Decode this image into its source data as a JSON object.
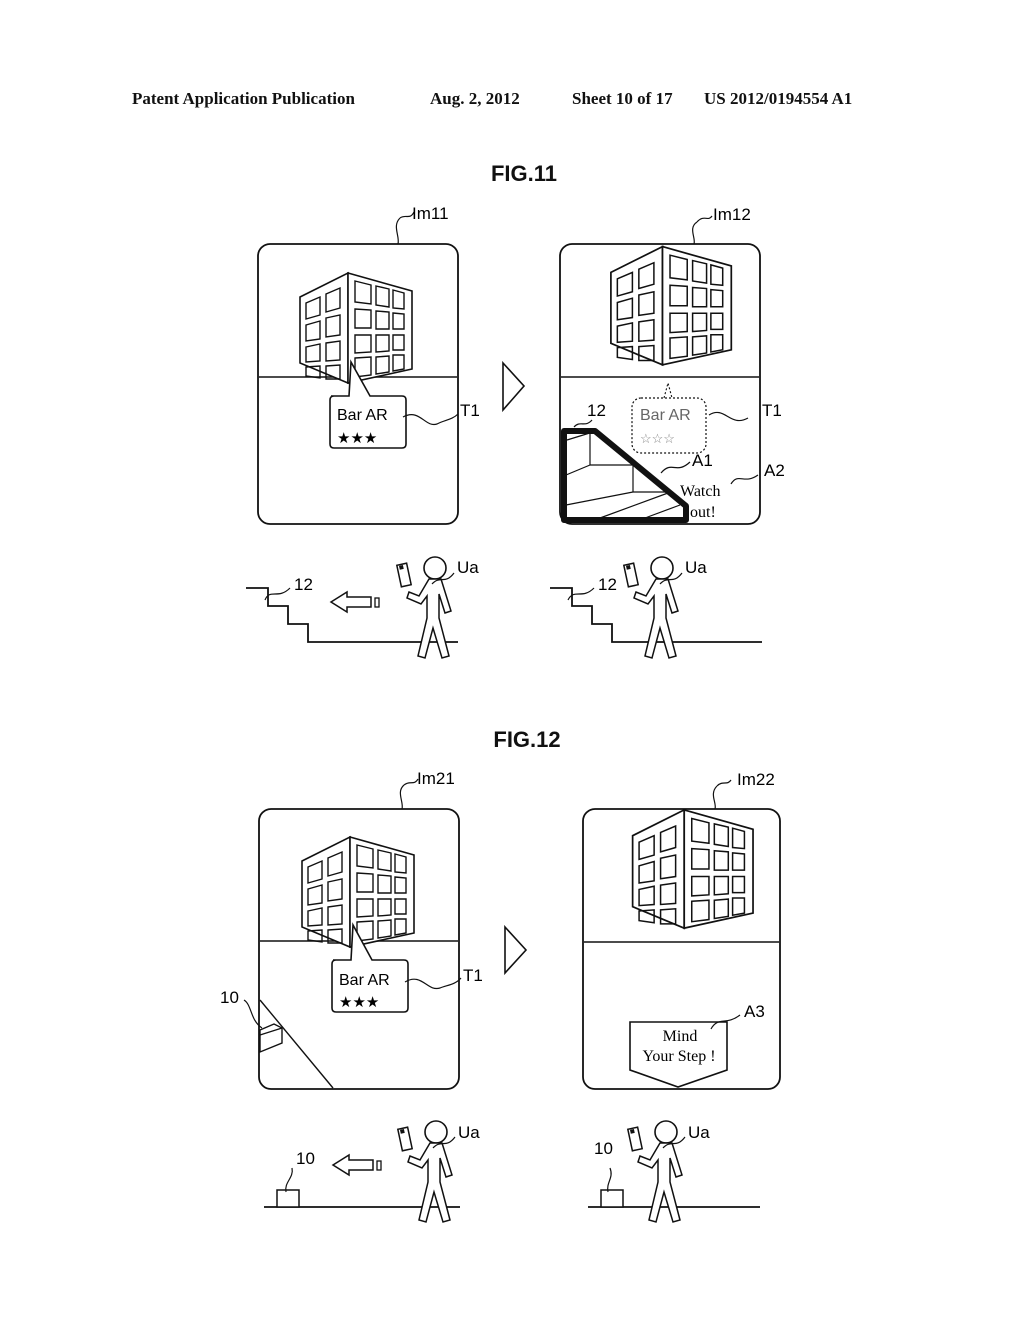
{
  "header": {
    "publication": "Patent Application Publication",
    "date": "Aug. 2, 2012",
    "sheet": "Sheet 10 of 17",
    "number": "US 2012/0194554 A1"
  },
  "figures": [
    {
      "title": "FIG.11",
      "panels": [
        {
          "label": "Im11",
          "tag_label": "T1",
          "tag_text": "Bar AR",
          "tag_stars": "★★★"
        },
        {
          "label": "Im12",
          "tag_label": "T1",
          "tag_text": "Bar AR",
          "tag_stars": "☆☆☆",
          "stairs_label": "12",
          "highlight_label": "A1",
          "warning_label": "A2",
          "warning_line1": "Watch",
          "warning_line2": "out!"
        }
      ],
      "scenes": [
        {
          "object_label": "12",
          "user_label": "Ua"
        },
        {
          "object_label": "12",
          "user_label": "Ua"
        }
      ]
    },
    {
      "title": "FIG.12",
      "panels": [
        {
          "label": "Im21",
          "tag_label": "T1",
          "tag_text": "Bar AR",
          "tag_stars": "★★★",
          "object_label": "10"
        },
        {
          "label": "Im22",
          "warning_label": "A3",
          "warning_line1": "Mind",
          "warning_line2": "Your Step !"
        }
      ],
      "scenes": [
        {
          "object_label": "10",
          "user_label": "Ua"
        },
        {
          "object_label": "10",
          "user_label": "Ua"
        }
      ]
    }
  ]
}
